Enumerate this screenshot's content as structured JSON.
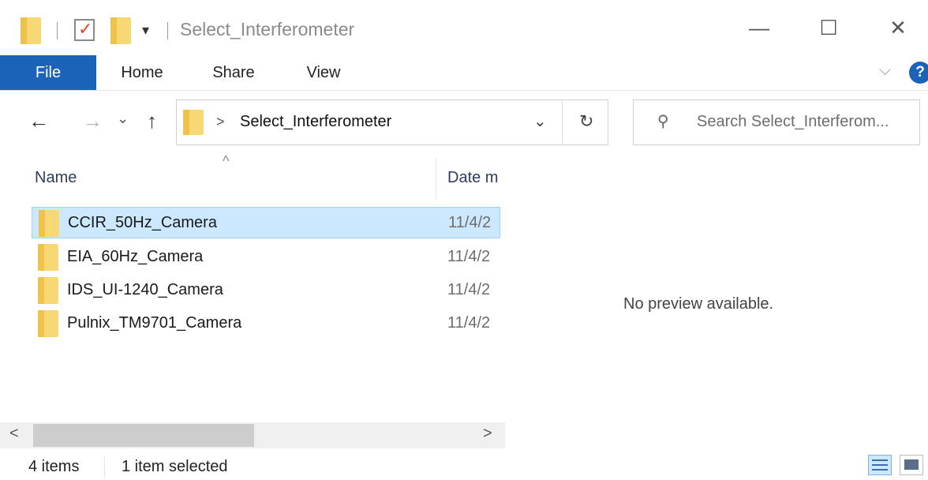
{
  "window": {
    "title": "Select_Interferometer",
    "minimize_glyph": "—",
    "maximize_glyph": "☐",
    "close_glyph": "✕",
    "qat_dropdown_glyph": "▾"
  },
  "ribbon": {
    "tabs": [
      "File",
      "Home",
      "Share",
      "View"
    ],
    "expand_glyph": "⌵",
    "help_glyph": "?"
  },
  "nav": {
    "back_glyph": "←",
    "forward_glyph": "→",
    "recent_glyph": "⌄",
    "up_glyph": "↑",
    "breadcrumb_sep": ">",
    "path": "Select_Interferometer",
    "dropdown_glyph": "⌄",
    "refresh_glyph": "↻",
    "search_glyph": "⚲",
    "search_placeholder": "Search Select_Interferom..."
  },
  "columns": {
    "name": "Name",
    "date": "Date m",
    "sort_glyph": "^"
  },
  "files": [
    {
      "name": "CCIR_50Hz_Camera",
      "date": "11/4/2",
      "selected": true
    },
    {
      "name": "EIA_60Hz_Camera",
      "date": "11/4/2",
      "selected": false
    },
    {
      "name": "IDS_UI-1240_Camera",
      "date": "11/4/2",
      "selected": false
    },
    {
      "name": "Pulnix_TM9701_Camera",
      "date": "11/4/2",
      "selected": false
    }
  ],
  "preview": {
    "message": "No preview available."
  },
  "scrollbar": {
    "left_glyph": "<",
    "right_glyph": ">"
  },
  "status": {
    "item_count": "4 items",
    "selection": "1 item selected"
  },
  "colors": {
    "accent": "#1a63b9",
    "selection_bg": "#cce8ff",
    "folder": "#f8d775"
  }
}
